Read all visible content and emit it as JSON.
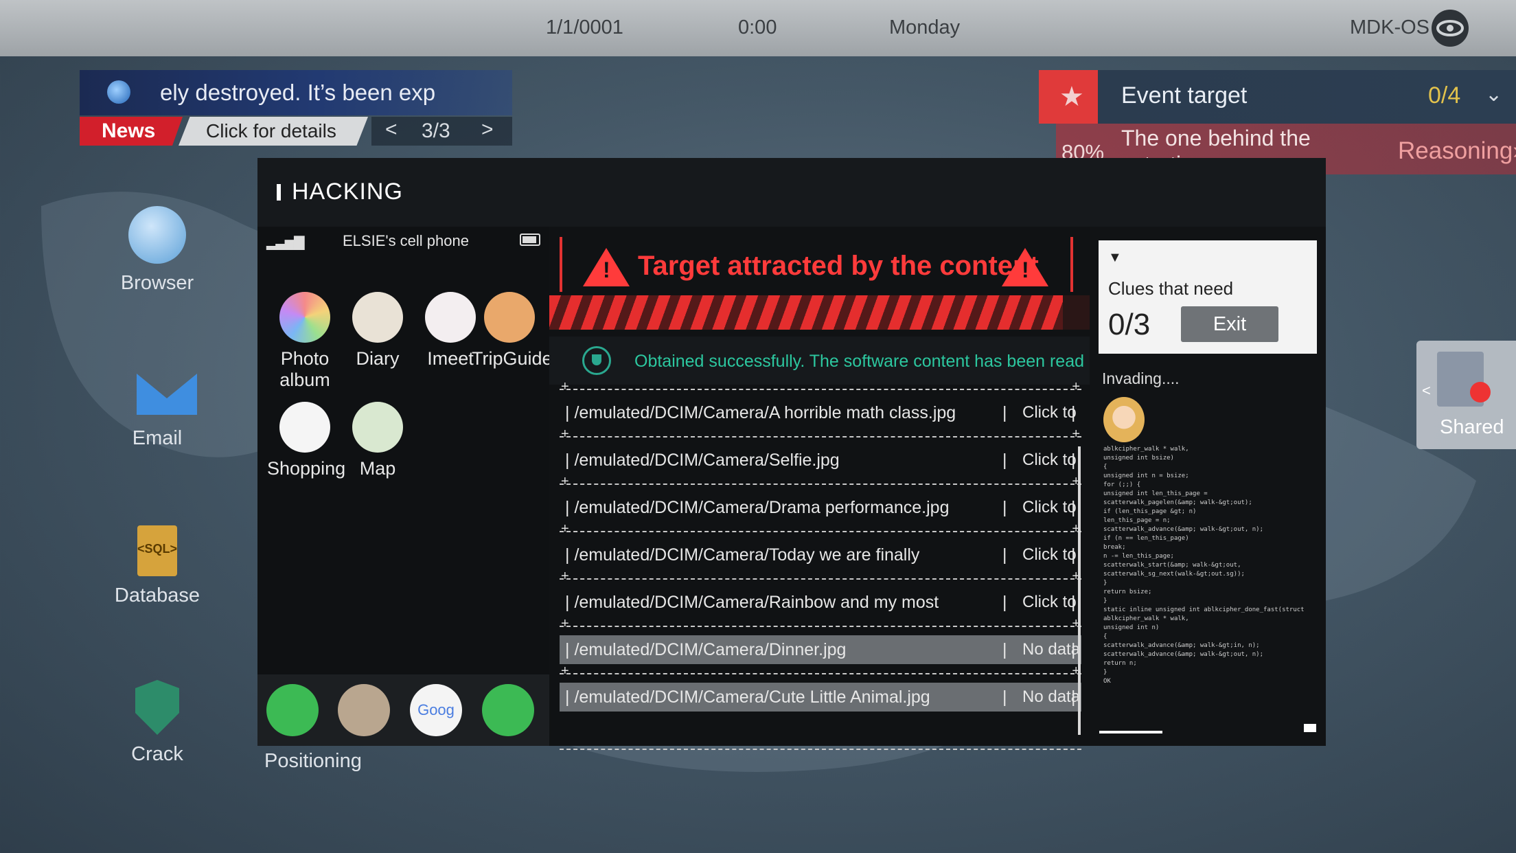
{
  "topbar": {
    "date": "1/1/0001",
    "time": "0:00",
    "day": "Monday",
    "os": "MDK-OS"
  },
  "news": {
    "text": "ely destroyed.  It’s been exp",
    "tag": "News",
    "details": "Click for details",
    "prev": "<",
    "page": "3/3",
    "next": ">"
  },
  "event": {
    "star": "★",
    "title": "Event target",
    "count": "0/4",
    "chevron": "⌄",
    "percent": "80%",
    "description": "The one behind the extortion",
    "reasoning": "Reasoning›"
  },
  "desktop": [
    {
      "label": "Browser"
    },
    {
      "label": "Email"
    },
    {
      "label": "Database"
    },
    {
      "label": "Crack"
    }
  ],
  "db_icon_text": "<SQL>",
  "hacking": {
    "title": "HACKING",
    "phone": {
      "name": "ELSIE's cell phone",
      "apps": [
        {
          "label": "Photo album"
        },
        {
          "label": "Diary"
        },
        {
          "label": "Imeet"
        },
        {
          "label": "TripGuide"
        },
        {
          "label": "Shopping"
        },
        {
          "label": "Map"
        }
      ],
      "dock_google": "Goog",
      "positioning": "Positioning"
    },
    "alert": "Target attracted by the content",
    "obtained": "Obtained successfully. The software content has been read",
    "files": [
      {
        "path": "| /emulated/DCIM/Camera/A horrible math class.jpg",
        "sep": "|",
        "action": "Click to",
        "end": "|"
      },
      {
        "path": "| /emulated/DCIM/Camera/Selfie.jpg",
        "sep": "|",
        "action": "Click to",
        "end": "|"
      },
      {
        "path": "| /emulated/DCIM/Camera/Drama performance.jpg",
        "sep": "|",
        "action": "Click to",
        "end": "|"
      },
      {
        "path": "| /emulated/DCIM/Camera/Today we are finally",
        "sep": "|",
        "action": "Click to",
        "end": "|"
      },
      {
        "path": "| /emulated/DCIM/Camera/Rainbow and my most",
        "sep": "|",
        "action": "Click to",
        "end": "|"
      },
      {
        "path": "| /emulated/DCIM/Camera/Dinner.jpg",
        "sep": "|",
        "action": "No data",
        "end": "|"
      },
      {
        "path": "| /emulated/DCIM/Camera/Cute Little Animal.jpg",
        "sep": "|",
        "action": "No data",
        "end": "|"
      }
    ],
    "clue": {
      "arrow": "▼",
      "title": "Clues that need",
      "count": "0/3",
      "exit": "Exit",
      "invading": "Invading....",
      "code": "ablkcipher_walk * walk,\nunsigned int bsize)\n{\nunsigned int n = bsize;\nfor (;;) {\nunsigned int len_this_page =\nscatterwalk_pagelen(&amp; walk-&gt;out);\nif (len_this_page &gt; n)\nlen_this_page = n;\nscatterwalk_advance(&amp; walk-&gt;out, n);\nif (n == len_this_page)\nbreak;\nn -= len_this_page;\nscatterwalk_start(&amp; walk-&gt;out,\nscatterwalk_sg_next(walk-&gt;out.sg));\n}\nreturn bsize;\n}\nstatic inline unsigned int ablkcipher_done_fast(struct\nablkcipher_walk * walk,\nunsigned int n)\n{\nscatterwalk_advance(&amp; walk-&gt;in, n);\nscatterwalk_advance(&amp; walk-&gt;out, n);\nreturn n;\n}\nOK"
    }
  },
  "shared": {
    "label": "Shared",
    "chevron": "<"
  }
}
